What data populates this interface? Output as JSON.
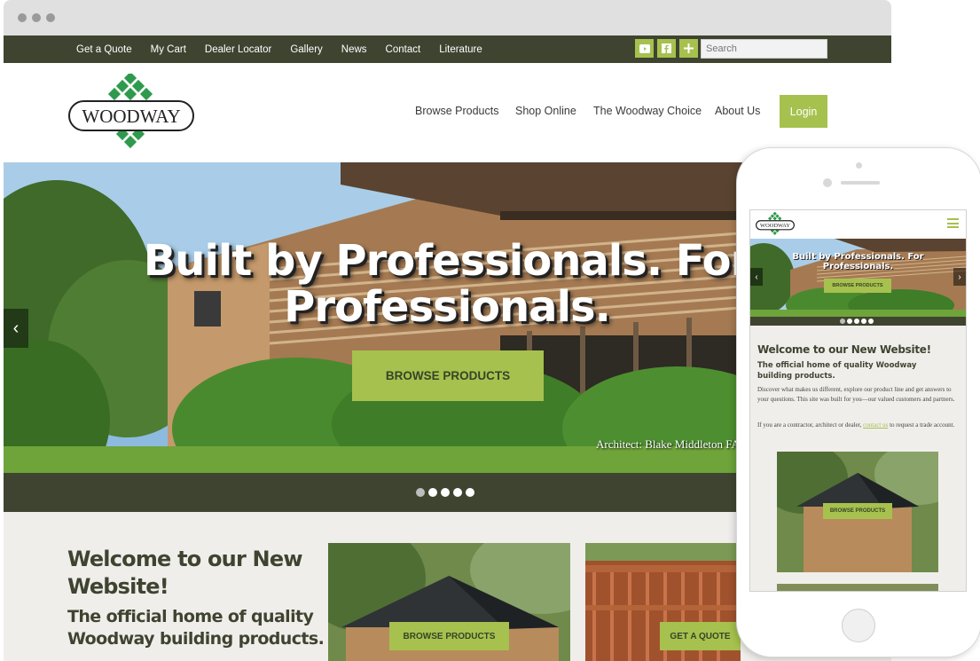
{
  "top_nav": {
    "links": [
      "Get a Quote",
      "My Cart",
      "Dealer Locator",
      "Gallery",
      "News",
      "Contact",
      "Literature"
    ],
    "search_placeholder": "Search",
    "social_icons": [
      "youtube-icon",
      "facebook-icon",
      "google-plus-icon"
    ]
  },
  "logo": {
    "text": "WOODWAY"
  },
  "main_nav": {
    "links": [
      "Browse Products",
      "Shop Online",
      "The Woodway Choice",
      "About Us"
    ],
    "login": "Login"
  },
  "hero": {
    "title": "Built by Professionals. For Professionals.",
    "button": "BROWSE PRODUCTS",
    "caption": "Architect: Blake Middleton FA",
    "slide_count": 5,
    "active_slide": 1
  },
  "content": {
    "welcome": "Welcome to our New Website!",
    "subhead": "The official home of quality Woodway building products.",
    "cards": [
      {
        "button": "BROWSE PRODUCTS"
      },
      {
        "button": "GET A QUOTE"
      }
    ]
  },
  "mobile": {
    "logo": "WOODWAY",
    "hero_title": "Built by Professionals. For Professionals.",
    "hero_button": "BROWSE PRODUCTS",
    "welcome": "Welcome to our New Website!",
    "subhead": "The official home of quality Woodway building products.",
    "para1": "Discover what makes us different, explore our product line and get answers to your questions. This site was built for you—our valued customers and partners.",
    "para2_before": "If you are a contractor, architect or dealer, ",
    "para2_link": "contact us",
    "para2_after": " to request a trade account.",
    "card_button": "BROWSE PRODUCTS"
  },
  "colors": {
    "olive_dark": "#3f4430",
    "accent_green": "#a6c14e",
    "logo_green": "#2e9a4c",
    "background": "#f0eeeb"
  }
}
